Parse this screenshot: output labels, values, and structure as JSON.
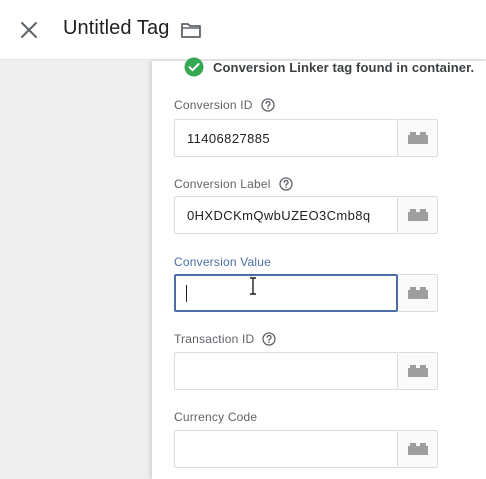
{
  "header": {
    "title": "Untitled Tag",
    "close_icon": "close-icon",
    "folder_icon": "folder-icon"
  },
  "status": {
    "message": "Conversion Linker tag found in container.",
    "icon": "check-circle-icon",
    "color": "#34a853"
  },
  "fields": [
    {
      "label": "Conversion ID",
      "value": "11406827885",
      "has_help": true
    },
    {
      "label": "Conversion Label",
      "value": "0HXDCKmQwbUZEO3Cmb8q",
      "has_help": true
    },
    {
      "label": "Conversion Value",
      "value": "",
      "has_help": false,
      "focused": true
    },
    {
      "label": "Transaction ID",
      "value": "",
      "has_help": true
    },
    {
      "label": "Currency Code",
      "value": "",
      "has_help": false
    }
  ],
  "colors": {
    "focus_accent": "#4a6fa5",
    "success_green": "#34a853",
    "variable_icon_gray": "#9e9e9e"
  }
}
